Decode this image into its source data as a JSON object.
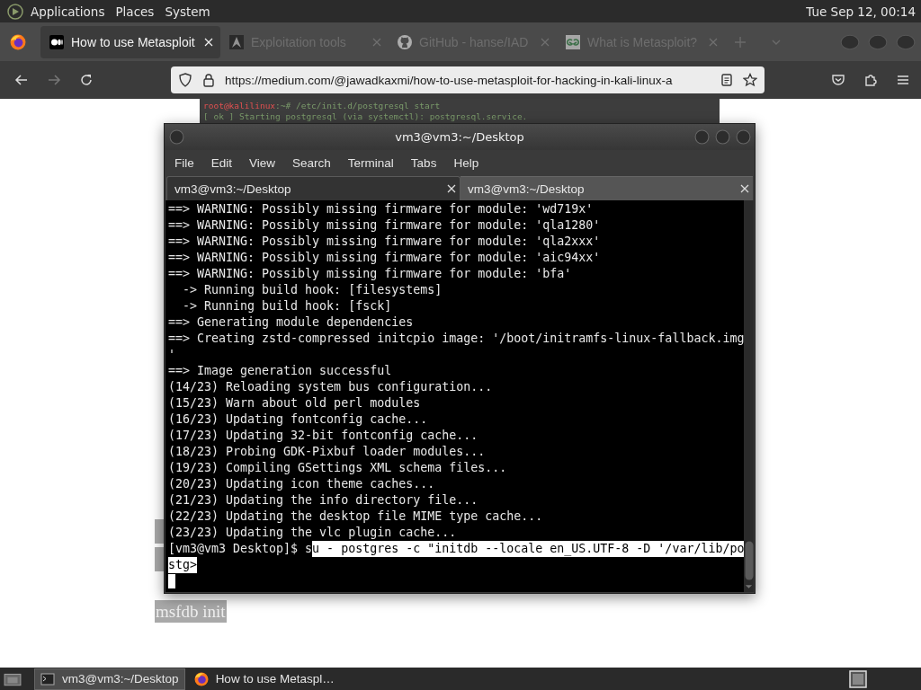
{
  "desktop_panel": {
    "menus": [
      "Applications",
      "Places",
      "System"
    ],
    "clock": "Tue Sep 12, 00:14"
  },
  "browser": {
    "tabs": [
      {
        "title": "How to use Metasploit",
        "selected": true
      },
      {
        "title": "Exploitation tools",
        "selected": false
      },
      {
        "title": "GitHub - hanse/IAD",
        "selected": false
      },
      {
        "title": "What is Metasploit?",
        "selected": false
      }
    ],
    "url": "https://medium.com/@jawadkaxmi/how-to-use-metasploit-for-hacking-in-kali-linux-a"
  },
  "page": {
    "screenshot_lines": [
      {
        "user": "root@kalilinux",
        "rest": ":~# /etc/init.d/postgresql start"
      },
      {
        "rest": "[ ok ] Starting postgresql (via systemctl): postgresql.service."
      }
    ],
    "selected_text": "msfdb init"
  },
  "terminal": {
    "title": "vm3@vm3:~/Desktop",
    "menu": [
      "File",
      "Edit",
      "View",
      "Search",
      "Terminal",
      "Tabs",
      "Help"
    ],
    "tabs": [
      {
        "label": "vm3@vm3:~/Desktop",
        "selected": true
      },
      {
        "label": "vm3@vm3:~/Desktop",
        "selected": false
      }
    ],
    "lines": [
      "==> WARNING: Possibly missing firmware for module: 'wd719x'",
      "==> WARNING: Possibly missing firmware for module: 'qla1280'",
      "==> WARNING: Possibly missing firmware for module: 'qla2xxx'",
      "==> WARNING: Possibly missing firmware for module: 'aic94xx'",
      "==> WARNING: Possibly missing firmware for module: 'bfa'",
      "  -> Running build hook: [filesystems]",
      "  -> Running build hook: [fsck]",
      "==> Generating module dependencies",
      "==> Creating zstd-compressed initcpio image: '/boot/initramfs-linux-fallback.img",
      "'",
      "==> Image generation successful",
      "(14/23) Reloading system bus configuration...",
      "(15/23) Warn about old perl modules",
      "(16/23) Updating fontconfig cache...",
      "(17/23) Updating 32-bit fontconfig cache...",
      "(18/23) Probing GDK-Pixbuf loader modules...",
      "(19/23) Compiling GSettings XML schema files...",
      "(20/23) Updating icon theme caches...",
      "(21/23) Updating the info directory file...",
      "(22/23) Updating the desktop file MIME type cache...",
      "(23/23) Updating the vlc plugin cache..."
    ],
    "prompt": "[vm3@vm3 Desktop]$ ",
    "command_plain": "s",
    "command_selected": "u - postgres -c \"initdb --locale en_US.UTF-8 -D '/var/lib/po",
    "continuation_selected": "stg>"
  },
  "taskbar": {
    "tasks": [
      {
        "label": "vm3@vm3:~/Desktop",
        "selected": true
      },
      {
        "label": "How to use Metaspl…",
        "selected": false
      }
    ]
  }
}
